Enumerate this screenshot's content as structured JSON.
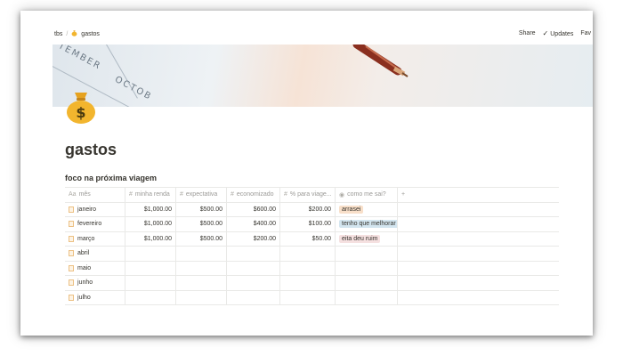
{
  "breadcrumb": {
    "parent": "tbs",
    "separator": "/",
    "current": "gastos"
  },
  "top_actions": {
    "share": "Share",
    "updates": "Updates",
    "favorite": "Fav"
  },
  "cover": {
    "text_1": "TEMBER",
    "text_2": "OCTOB"
  },
  "page": {
    "title": "gastos",
    "icon": "money-bag-icon"
  },
  "database": {
    "title": "foco na próxima viagem",
    "columns": [
      {
        "label": "mês",
        "icon": "Aa"
      },
      {
        "label": "minha renda",
        "icon": "#"
      },
      {
        "label": "expectativa",
        "icon": "#"
      },
      {
        "label": "economizado",
        "icon": "#"
      },
      {
        "label": "% para viage...",
        "icon": "#"
      },
      {
        "label": "como me sai?",
        "icon": "◉"
      },
      {
        "label": "+",
        "icon": ""
      }
    ],
    "rows": [
      {
        "mes": "janeiro",
        "renda": "$1,000.00",
        "expectativa": "$500.00",
        "economizado": "$600.00",
        "percent": "$200.00",
        "tag": "arrasei",
        "tag_color": "#f8dfc9"
      },
      {
        "mes": "fevereiro",
        "renda": "$1,000.00",
        "expectativa": "$500.00",
        "economizado": "$400.00",
        "percent": "$100.00",
        "tag": "tenho que melhorar",
        "tag_color": "#d3e5ef"
      },
      {
        "mes": "março",
        "renda": "$1,000.00",
        "expectativa": "$500.00",
        "economizado": "$200.00",
        "percent": "$50.00",
        "tag": "eita deu ruim",
        "tag_color": "#f5e0e0"
      },
      {
        "mes": "abril",
        "renda": "",
        "expectativa": "",
        "economizado": "",
        "percent": "",
        "tag": "",
        "tag_color": ""
      },
      {
        "mes": "maio",
        "renda": "",
        "expectativa": "",
        "economizado": "",
        "percent": "",
        "tag": "",
        "tag_color": ""
      },
      {
        "mes": "junho",
        "renda": "",
        "expectativa": "",
        "economizado": "",
        "percent": "",
        "tag": "",
        "tag_color": ""
      },
      {
        "mes": "julho",
        "renda": "",
        "expectativa": "",
        "economizado": "",
        "percent": "",
        "tag": "",
        "tag_color": ""
      }
    ]
  },
  "colors": {
    "text": "#37352f",
    "muted": "#9b9a97",
    "border": "#e9e9e7",
    "bag": "#f2b52e"
  }
}
